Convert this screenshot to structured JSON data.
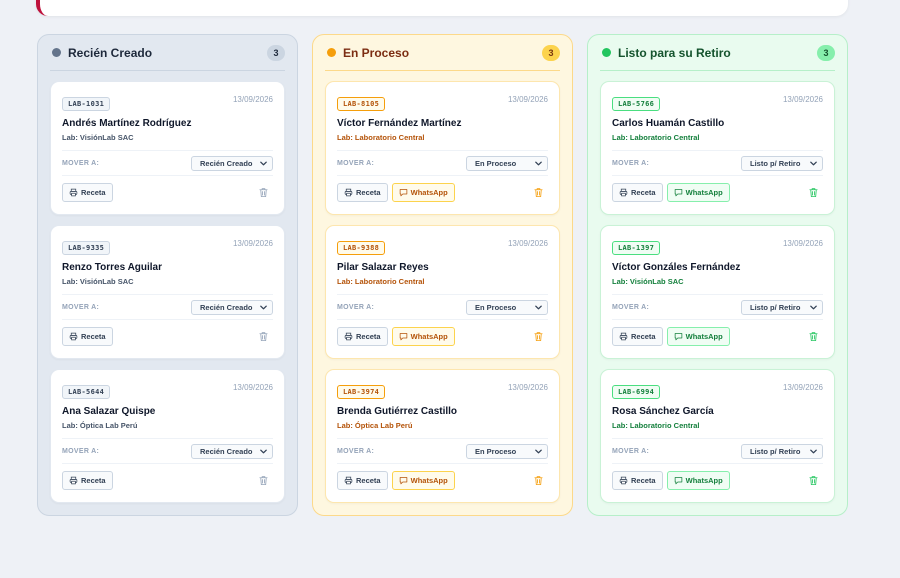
{
  "columns": [
    {
      "title": "Recién Creado",
      "count": "3",
      "variant": "gray",
      "cards": [
        {
          "code": "LAB-1031",
          "date": "13/09/2026",
          "name": "Andrés Martínez Rodríguez",
          "lab": "Lab: VisiónLab SAC",
          "move_label": "MOVER A:",
          "status": "Recién Creado",
          "receta": "Receta"
        },
        {
          "code": "LAB-9335",
          "date": "13/09/2026",
          "name": "Renzo Torres Aguilar",
          "lab": "Lab: VisiónLab SAC",
          "move_label": "MOVER A:",
          "status": "Recién Creado",
          "receta": "Receta"
        },
        {
          "code": "LAB-5644",
          "date": "13/09/2026",
          "name": "Ana Salazar Quispe",
          "lab": "Lab: Óptica Lab Perú",
          "move_label": "MOVER A:",
          "status": "Recién Creado",
          "receta": "Receta"
        }
      ]
    },
    {
      "title": "En Proceso",
      "count": "3",
      "variant": "amber",
      "cards": [
        {
          "code": "LAB-8105",
          "date": "13/09/2026",
          "name": "Víctor Fernández Martínez",
          "lab": "Lab: Laboratorio Central",
          "move_label": "MOVER A:",
          "status": "En Proceso",
          "receta": "Receta",
          "whatsapp": "WhatsApp"
        },
        {
          "code": "LAB-9388",
          "date": "13/09/2026",
          "name": "Pilar Salazar Reyes",
          "lab": "Lab: Laboratorio Central",
          "move_label": "MOVER A:",
          "status": "En Proceso",
          "receta": "Receta",
          "whatsapp": "WhatsApp"
        },
        {
          "code": "LAB-3974",
          "date": "13/09/2026",
          "name": "Brenda Gutiérrez Castillo",
          "lab": "Lab: Óptica Lab Perú",
          "move_label": "MOVER A:",
          "status": "En Proceso",
          "receta": "Receta",
          "whatsapp": "WhatsApp"
        }
      ]
    },
    {
      "title": "Listo para su Retiro",
      "count": "3",
      "variant": "green",
      "cards": [
        {
          "code": "LAB-5766",
          "date": "13/09/2026",
          "name": "Carlos Huamán Castillo",
          "lab": "Lab: Laboratorio Central",
          "move_label": "MOVER A:",
          "status": "Listo p/ Retiro",
          "receta": "Receta",
          "whatsapp": "WhatsApp"
        },
        {
          "code": "LAB-1397",
          "date": "13/09/2026",
          "name": "Víctor Gonzáles Fernández",
          "lab": "Lab: VisiónLab SAC",
          "move_label": "MOVER A:",
          "status": "Listo p/ Retiro",
          "receta": "Receta",
          "whatsapp": "WhatsApp"
        },
        {
          "code": "LAB-6994",
          "date": "13/09/2026",
          "name": "Rosa Sánchez García",
          "lab": "Lab: Laboratorio Central",
          "move_label": "MOVER A:",
          "status": "Listo p/ Retiro",
          "receta": "Receta",
          "whatsapp": "WhatsApp"
        }
      ]
    }
  ],
  "colors": {
    "gray_accent": "#64748b",
    "amber_accent": "#f59e0b",
    "green_accent": "#22c55e"
  },
  "icons": {
    "status_dot": "status-dot-icon",
    "dropdown": "chevron-down-icon",
    "print": "printer-icon",
    "chat": "chat-icon",
    "delete": "trash-icon"
  }
}
